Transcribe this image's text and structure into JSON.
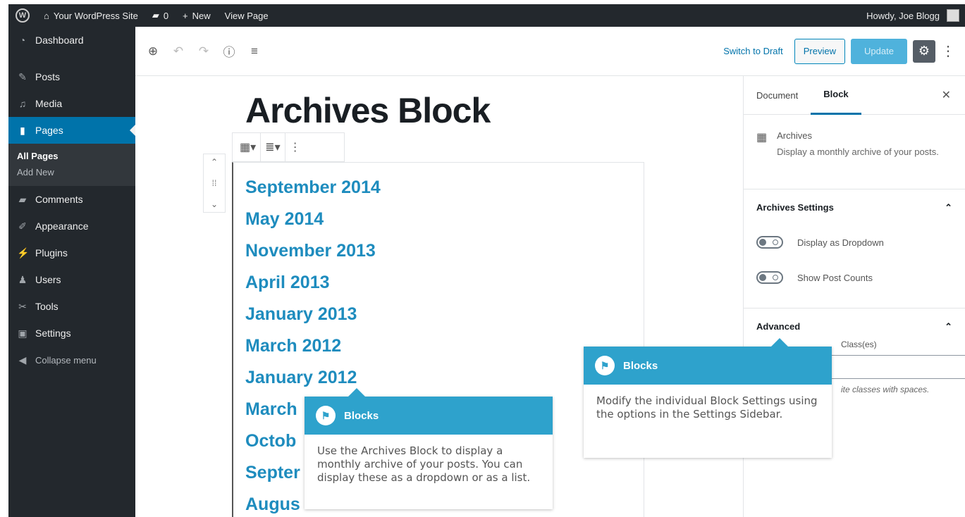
{
  "admin_bar": {
    "site_name": "Your WordPress Site",
    "comments_count": "0",
    "new_label": "New",
    "view_page_label": "View Page",
    "howdy": "Howdy, Joe Blogg"
  },
  "sidebar": {
    "items": [
      {
        "label": "Dashboard",
        "icon": "dashboard-icon"
      },
      {
        "label": "Posts",
        "icon": "pin-icon"
      },
      {
        "label": "Media",
        "icon": "media-icon"
      },
      {
        "label": "Pages",
        "icon": "page-icon"
      },
      {
        "label": "Comments",
        "icon": "comment-icon"
      },
      {
        "label": "Appearance",
        "icon": "brush-icon"
      },
      {
        "label": "Plugins",
        "icon": "plug-icon"
      },
      {
        "label": "Users",
        "icon": "users-icon"
      },
      {
        "label": "Tools",
        "icon": "wrench-icon"
      },
      {
        "label": "Settings",
        "icon": "settings-icon"
      },
      {
        "label": "Collapse menu",
        "icon": "collapse-icon"
      }
    ],
    "submenu": [
      "All Pages",
      "Add New"
    ]
  },
  "editor_header": {
    "switch_to_draft": "Switch to Draft",
    "preview": "Preview",
    "update": "Update"
  },
  "content": {
    "title": "Archives Block",
    "archives": [
      "September 2014",
      "May 2014",
      "November 2013",
      "April 2013",
      "January 2013",
      "March 2012",
      "January 2012",
      "March",
      "Octob",
      "Septer",
      "Augus"
    ]
  },
  "panel": {
    "tabs": [
      "Document",
      "Block"
    ],
    "block_name": "Archives",
    "block_desc": "Display a monthly archive of your posts.",
    "settings_title": "Archives Settings",
    "toggles": [
      "Display as Dropdown",
      "Show Post Counts"
    ],
    "advanced_title": "Advanced",
    "class_label": "Class(es)",
    "class_help": "ite classes with spaces."
  },
  "tooltips": {
    "left": {
      "title": "Blocks",
      "body": "Use the Archives Block to display a monthly archive of your posts. You can display these as a dropdown or as a list."
    },
    "right": {
      "title": "Blocks",
      "body": "Modify the individual Block Settings using the options in the Settings Sidebar."
    }
  },
  "colors": {
    "admin_dark": "#23282d",
    "accent": "#0073aa",
    "link_blue": "#1e8cbe",
    "tooltip_blue": "#2ea2cc"
  }
}
